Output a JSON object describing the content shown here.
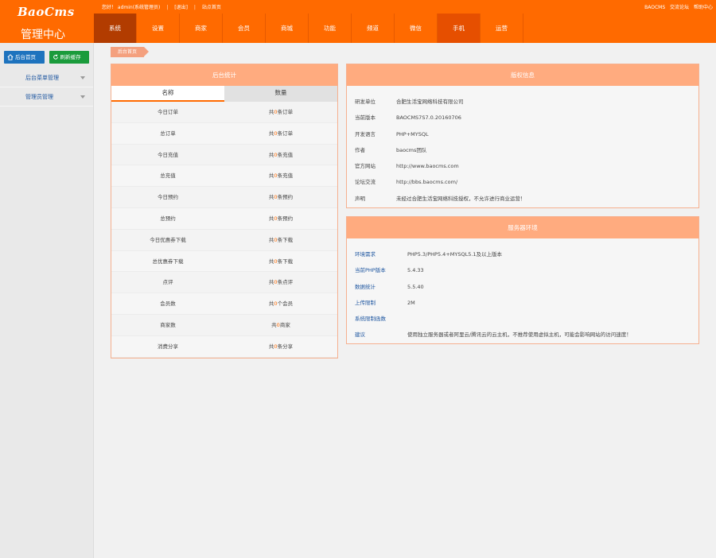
{
  "logo": {
    "brand": "BaoCms",
    "subtitle": "管理中心"
  },
  "topbar": {
    "greeting": "您好！ admin(系统管理员)",
    "logout": "[退出]",
    "home": "站点首页",
    "right_links": [
      "BAOCMS",
      "交流论坛",
      "帮助中心"
    ]
  },
  "nav": [
    "系统",
    "设置",
    "商家",
    "会员",
    "商城",
    "功能",
    "频道",
    "微信",
    "手机",
    "运营"
  ],
  "sidebar": {
    "buttons": [
      "后台首页",
      "刷新缓存"
    ],
    "items": [
      "后台菜单管理",
      "管理员管理"
    ]
  },
  "breadcrumb": "后台首页",
  "stats": {
    "title": "后台统计",
    "headers": [
      "名称",
      "数量"
    ],
    "rows": [
      {
        "name": "今日订单",
        "pre": "共",
        "num": "0",
        "post": "条订单"
      },
      {
        "name": "总订单",
        "pre": "共",
        "num": "0",
        "post": "条订单"
      },
      {
        "name": "今日充值",
        "pre": "共",
        "num": "0",
        "post": "条充值"
      },
      {
        "name": "总充值",
        "pre": "共",
        "num": "0",
        "post": "条充值"
      },
      {
        "name": "今日预约",
        "pre": "共",
        "num": "0",
        "post": "条预约"
      },
      {
        "name": "总预约",
        "pre": "共",
        "num": "0",
        "post": "条预约"
      },
      {
        "name": "今日优惠券下载",
        "pre": "共",
        "num": "0",
        "post": "条下载"
      },
      {
        "name": "总优惠券下载",
        "pre": "共",
        "num": "0",
        "post": "条下载"
      },
      {
        "name": "点评",
        "pre": "共",
        "num": "0",
        "post": "条点评"
      },
      {
        "name": "会员数",
        "pre": "共",
        "num": "0",
        "post": "个会员"
      },
      {
        "name": "商家数",
        "pre": "共",
        "num": "0",
        "post": "商家"
      },
      {
        "name": "消费分享",
        "pre": "共",
        "num": "0",
        "post": "条分享"
      }
    ]
  },
  "copyright": {
    "title": "版权信息",
    "rows": [
      {
        "k": "研发单位",
        "v": "合肥生活宝网络科技有限公司"
      },
      {
        "k": "当前版本",
        "v": "BAOCMS7S7.0.20160706"
      },
      {
        "k": "开发语言",
        "v": "PHP+MYSQL"
      },
      {
        "k": "作者",
        "v": "baocms团队"
      },
      {
        "k": "官方网站",
        "v": "http://www.baocms.com"
      },
      {
        "k": "论坛交流",
        "v": "http://bbs.baocms.com/"
      },
      {
        "k": "声明",
        "v": "未经过合肥生活宝网络科技授权，不允许进行商业运营！"
      }
    ]
  },
  "env": {
    "title": "服务器环境",
    "rows": [
      {
        "k": "环境需求",
        "v": "PHP5.3/PHP5.4+MYSQL5.1及以上版本"
      },
      {
        "k": "当前PHP版本",
        "v": "5.4.33"
      },
      {
        "k": "数据统计",
        "v": "5.5.40"
      },
      {
        "k": "上传限制",
        "v": "2M"
      },
      {
        "k": "系统限制函数",
        "v": ""
      },
      {
        "k": "建议",
        "v": "使用独立服务器或者阿里云/腾讯云的云主机，不推荐使用虚拟主机，可能会影响网站的访问速度！"
      }
    ]
  }
}
